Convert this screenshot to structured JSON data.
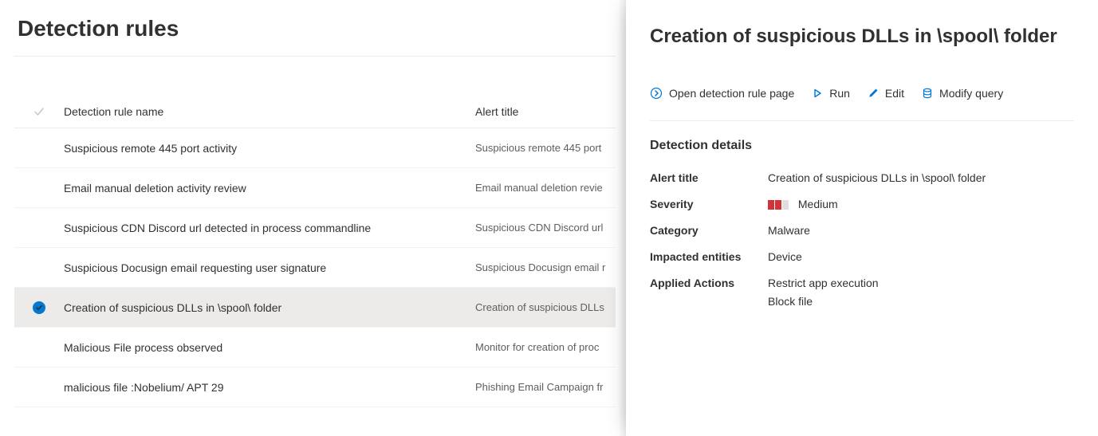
{
  "page": {
    "title": "Detection rules"
  },
  "columns": {
    "name_header": "Detection rule name",
    "alert_header": "Alert title"
  },
  "rules": [
    {
      "name": "Suspicious remote 445 port activity",
      "alert": "Suspicious remote 445 port",
      "selected": false
    },
    {
      "name": "Email manual deletion activity review",
      "alert": "Email manual deletion revie",
      "selected": false
    },
    {
      "name": "Suspicious CDN Discord url detected in process commandline",
      "alert": "Suspicious CDN Discord url",
      "selected": false
    },
    {
      "name": "Suspicious Docusign email requesting user signature",
      "alert": "Suspicious Docusign email r",
      "selected": false
    },
    {
      "name": "Creation of suspicious DLLs in \\spool\\ folder",
      "alert": "Creation of suspicious DLLs",
      "selected": true
    },
    {
      "name": "Malicious File process observed",
      "alert": "Monitor for creation of proc",
      "selected": false
    },
    {
      "name": "malicious file :Nobelium/ APT 29",
      "alert": "Phishing Email Campaign fr",
      "selected": false
    }
  ],
  "actions": {
    "open": "Open detection rule page",
    "run": "Run",
    "edit": "Edit",
    "modify": "Modify query"
  },
  "details": {
    "title": "Creation of suspicious DLLs in \\spool\\ folder",
    "section_heading": "Detection details",
    "labels": {
      "alert_title": "Alert title",
      "severity": "Severity",
      "category": "Category",
      "impacted": "Impacted entities",
      "applied": "Applied Actions"
    },
    "values": {
      "alert_title": "Creation of suspicious DLLs in \\spool\\ folder",
      "severity": "Medium",
      "severity_level": 2,
      "category": "Malware",
      "impacted": "Device",
      "applied": [
        "Restrict app execution",
        "Block file"
      ]
    }
  },
  "colors": {
    "accent": "#0078d4",
    "severity_fill": "#d13438"
  }
}
